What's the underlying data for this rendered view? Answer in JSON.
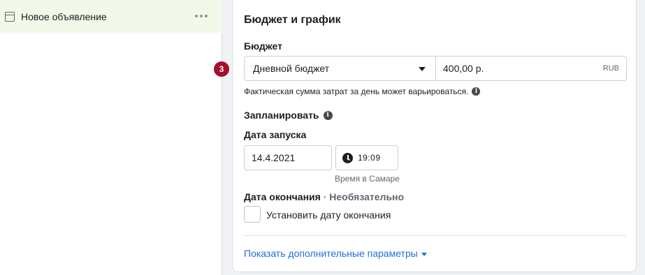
{
  "sidebar": {
    "ad_item": {
      "label": "Новое объявление",
      "icon": "document-icon"
    }
  },
  "budget_schedule": {
    "title": "Бюджет и график",
    "budget": {
      "label": "Бюджет",
      "step_badge": "3",
      "type_selected": "Дневной бюджет",
      "amount_value": "400,00 р.",
      "currency": "RUB",
      "help_text": "Фактическая сумма затрат за день может варьироваться."
    },
    "schedule": {
      "label": "Запланировать",
      "start_label": "Дата запуска",
      "start_date": "14.4.2021",
      "start_time": "19:09",
      "timezone_note": "Время в Самаре",
      "end_label": "Дата окончания",
      "end_optional": "· Необязательно",
      "end_checkbox_label": "Установить дату окончания",
      "end_checkbox_checked": false
    },
    "more_options_link": "Показать дополнительные параметры"
  },
  "colors": {
    "accent_link": "#216fdb",
    "badge": "#a50e2c",
    "selected_row_bg": "#f2f9ea"
  }
}
